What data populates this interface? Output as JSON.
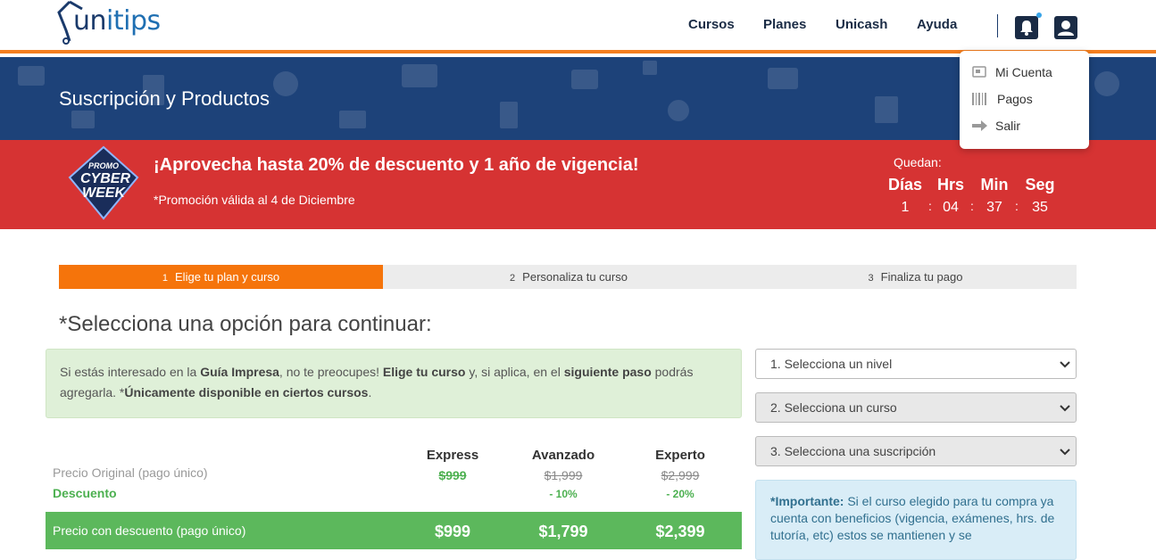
{
  "header": {
    "logo_text_u": "un",
    "logo_text_tips": "itips",
    "nav": [
      "Cursos",
      "Planes",
      "Unicash",
      "Ayuda"
    ]
  },
  "account_menu": {
    "items": [
      "Mi Cuenta",
      "Pagos",
      "Salir"
    ]
  },
  "hero": {
    "title": "Suscripción y Productos"
  },
  "promo": {
    "badge_top": "PROMO",
    "badge_main_1": "CYBER",
    "badge_main_2": "WEEK",
    "title": "¡Aprovecha hasta 20% de descuento y 1 año de vigencia!",
    "note": "*Promoción válida al 4 de Diciembre",
    "countdown_label": "Quedan:",
    "countdown": [
      {
        "label": "Días",
        "value": "1"
      },
      {
        "label": "Hrs",
        "value": "04"
      },
      {
        "label": "Min",
        "value": "37"
      },
      {
        "label": "Seg",
        "value": "35"
      }
    ]
  },
  "steps": [
    {
      "num": "1",
      "label": "Elige tu plan y curso",
      "active": true
    },
    {
      "num": "2",
      "label": "Personaliza tu curso",
      "active": false
    },
    {
      "num": "3",
      "label": "Finaliza tu pago",
      "active": false
    }
  ],
  "main": {
    "title": "*Selecciona una opción para continuar:",
    "info": {
      "t1": "Si estás interesado en la ",
      "b1": "Guía Impresa",
      "t2": ", no te preocupes! ",
      "b2": "Elige tu curso",
      "t3": " y, si aplica, en el ",
      "b3": "siguiente paso",
      "t4": " podrás agregarla. *",
      "b4": "Únicamente disponible en ciertos cursos",
      "t5": "."
    }
  },
  "selects": [
    {
      "value": "1. Selecciona un nivel"
    },
    {
      "value": "2. Selecciona un curso"
    },
    {
      "value": "3. Selecciona una suscripción"
    }
  ],
  "important": {
    "label": "*Importante:",
    "text": " Si el curso elegido para tu compra ya cuenta con beneficios (vigencia, exámenes, hrs. de tutoría, etc) estos se mantienen y se"
  },
  "pricing": {
    "original_label": "Precio Original (pago único)",
    "discount_label": "Descuento",
    "final_label": "Precio con descuento (pago único)",
    "plans": [
      {
        "name": "Express",
        "original": "$999",
        "discount": "",
        "final": "$999"
      },
      {
        "name": "Avanzado",
        "original": "$1,999",
        "discount": "- 10%",
        "final": "$1,799"
      },
      {
        "name": "Experto",
        "original": "$2,999",
        "discount": "- 20%",
        "final": "$2,399"
      }
    ]
  },
  "colors": {
    "orange": "#f5740b",
    "navy": "#1d4279",
    "red": "#d63333",
    "green": "#5cb85c"
  }
}
